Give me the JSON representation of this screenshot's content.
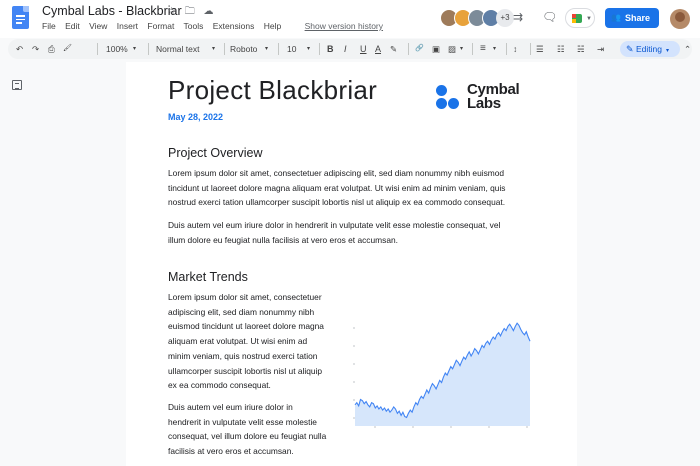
{
  "header": {
    "title": "Cymbal Labs - Blackbriar",
    "title_icons": "☆ 🗀 ☁",
    "menu": [
      "File",
      "Edit",
      "View",
      "Insert",
      "Format",
      "Tools",
      "Extensions",
      "Help"
    ],
    "version_history": "Show version history",
    "collaborator_overflow": "+3",
    "share_label": "Share",
    "share_color": "#1a73e8"
  },
  "toolbar": {
    "undo": "↶",
    "redo": "↷",
    "print": "⎙",
    "paint": "🖌",
    "zoom": "100%",
    "style": "Normal text",
    "font": "Roboto",
    "size": "10",
    "bold": "B",
    "italic": "I",
    "underline": "U",
    "text_color": "A",
    "highlight": "✎",
    "link": "🔗",
    "comment": "▣",
    "image": "▨",
    "align": "≡",
    "line_spacing": "↕",
    "list_check": "☰",
    "list_bullet": "☷",
    "list_number": "☵",
    "indent": "⇥",
    "mode": "Editing",
    "collapse": "⌃",
    "caret": "▾"
  },
  "document": {
    "title": "Project Blackbriar",
    "date": "May 28, 2022",
    "logo_text_1": "Cymbal",
    "logo_text_2": "Labs",
    "section1": {
      "heading": "Project Overview",
      "p1_lines": [
        "Lorem ipsum dolor sit amet, consectetuer adipiscing elit, sed diam nonummy nibh euismod",
        "tincidunt ut laoreet dolore magna aliquam erat volutpat. Ut wisi enim ad minim veniam, quis",
        "nostrud exerci tation ullamcorper suscipit lobortis nisl ut aliquip ex ea commodo consequat."
      ],
      "p2_lines": [
        "Duis autem vel eum iriure dolor in hendrerit in vulputate velit esse molestie consequat, vel",
        "illum dolore eu feugiat nulla facilisis at vero eros et accumsan."
      ]
    },
    "section2": {
      "heading": "Market Trends",
      "p1_lines": [
        "Lorem ipsum dolor sit amet, consectetuer",
        "adipiscing elit, sed diam nonummy nibh",
        "euismod tincidunt ut laoreet dolore magna",
        "aliquam erat volutpat. Ut wisi enim ad",
        "minim veniam, quis nostrud exerci tation",
        "ullamcorper suscipit lobortis nisl ut aliquip",
        "ex ea commodo consequat."
      ],
      "p2_lines": [
        "Duis autem vel eum iriure dolor in",
        "hendrerit in vulputate velit esse molestie",
        "consequat, vel illum dolore eu feugiat nulla",
        "facilisis at vero eros et accumsan."
      ]
    }
  },
  "chart_data": {
    "type": "area",
    "values": [
      20,
      22,
      19,
      25,
      24,
      21,
      23,
      20,
      18,
      22,
      21,
      17,
      19,
      16,
      18,
      15,
      17,
      14,
      16,
      13,
      15,
      18,
      16,
      12,
      14,
      10,
      13,
      9,
      8,
      12,
      15,
      13,
      18,
      22,
      20,
      25,
      28,
      26,
      30,
      34,
      31,
      36,
      40,
      38,
      35,
      39,
      43,
      41,
      46,
      50,
      48,
      52,
      56,
      54,
      58,
      62,
      60,
      57,
      61,
      65,
      63,
      67,
      70,
      66,
      69,
      73,
      71,
      68,
      72,
      76,
      74,
      78,
      80,
      77,
      81,
      84,
      82,
      86,
      88,
      85,
      89,
      92,
      90,
      94,
      96,
      93,
      90,
      94,
      97,
      95,
      91,
      88,
      86,
      89,
      84,
      80
    ],
    "ylim": [
      0,
      100
    ],
    "grid": false,
    "line_color": "#4285f4",
    "fill_color": "#d6e6fb"
  }
}
